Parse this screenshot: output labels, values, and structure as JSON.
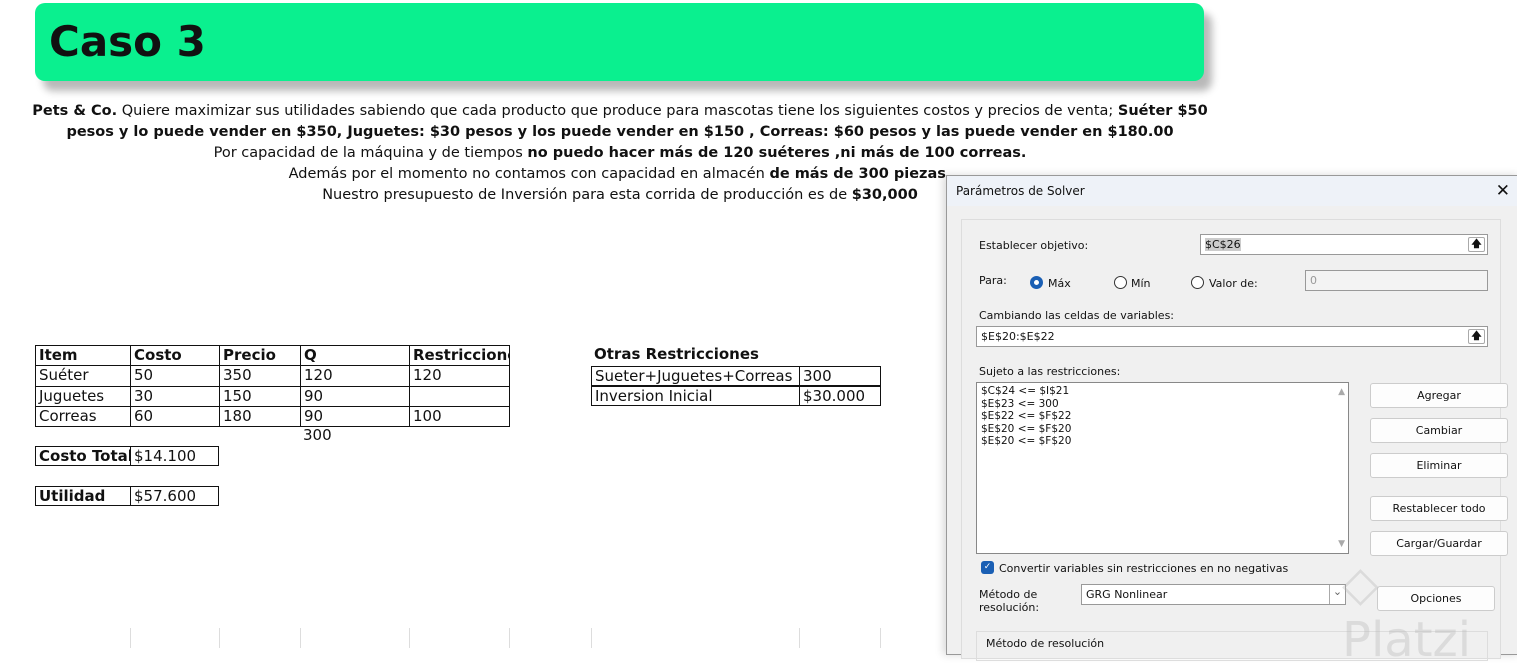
{
  "banner": {
    "title": "Caso 3"
  },
  "problem": {
    "l1a": "Pets & Co.",
    "l1b": " Quiere maximizar sus utilidades sabiendo que cada producto que produce para mascotas tiene los siguientes costos y precios de venta; ",
    "l1c": "Suéter $50",
    "l2": "pesos y lo puede vender en $350, Juguetes: $30 pesos y los puede vender en $150 , Correas: $60 pesos y las puede vender en $180.00",
    "l3a": "Por capacidad de la máquina y de tiempos ",
    "l3b": "no puedo hacer más de 120 suéteres ,ni más de 100 correas.",
    "l4a": "Además por el momento no contamos con capacidad en almacén ",
    "l4b": "de más de 300 piezas.",
    "l5a": "Nuestro presupuesto de Inversión para esta corrida de producción es de ",
    "l5b": "$30,000"
  },
  "table": {
    "headers": [
      "Item",
      "Costo",
      "Precio",
      "Q",
      "Restricciones"
    ],
    "rows": [
      [
        "Suéter",
        "50",
        "350",
        "120",
        "120"
      ],
      [
        "Juguetes",
        "30",
        "150",
        "90",
        ""
      ],
      [
        "Correas",
        "60",
        "180",
        "90",
        "100"
      ]
    ],
    "q_total": "300",
    "costo_total_label": "Costo Total",
    "costo_total": "$14.100",
    "utilidad_label": "Utilidad",
    "utilidad": "$57.600"
  },
  "otras": {
    "title": "Otras Restricciones",
    "rows": [
      [
        "Sueter+Juguetes+Correas",
        "300"
      ],
      [
        "Inversion Inicial",
        "$30.000"
      ]
    ]
  },
  "solver": {
    "title": "Parámetros de Solver",
    "objetivo_label": "Establecer objetivo:",
    "objetivo": "$C$26",
    "para_label": "Para:",
    "max": "Máx",
    "min": "Mín",
    "valor": "Valor de:",
    "valor_value": "0",
    "cambiando_label": "Cambiando las celdas de variables:",
    "cambiando": "$E$20:$E$22",
    "sujeto_label": "Sujeto a las restricciones:",
    "constraints": [
      "$C$24 <= $I$21",
      "$E$23 <= 300",
      "$E$22 <= $F$22",
      "$E$20 <= $F$20",
      "$E$20 <= $F$20"
    ],
    "buttons": {
      "agregar": "Agregar",
      "cambiar": "Cambiar",
      "eliminar": "Eliminar",
      "restablecer": "Restablecer todo",
      "cargar": "Cargar/Guardar",
      "opciones": "Opciones"
    },
    "convertir": "Convertir variables sin restricciones en no negativas",
    "metodo_label": "Método de resolución:",
    "metodo": "GRG Nonlinear",
    "metodo_group": "Método de resolución"
  },
  "watermark": "Platzi"
}
